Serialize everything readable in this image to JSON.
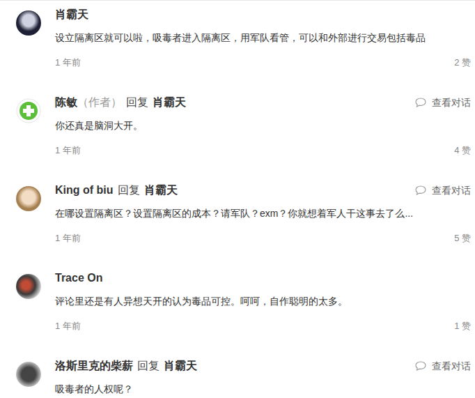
{
  "comments": [
    {
      "author": "肖霸天",
      "author_tag": "",
      "reply_label": "",
      "reply_to": "",
      "view_conversation": "",
      "text": "设立隔离区就可以啦，吸毒者进入隔离区，用军队看管，可以和外部进行交易包括毒品",
      "time": "1 年前",
      "likes": "2 赞"
    },
    {
      "author": "陈敏",
      "author_tag": "（作者）",
      "reply_label": "回复",
      "reply_to": "肖霸天",
      "view_conversation": "查看对话",
      "text": "你还真是脑洞大开。",
      "time": "1 年前",
      "likes": "4 赞"
    },
    {
      "author": "King of biu",
      "author_tag": "",
      "reply_label": "回复",
      "reply_to": "肖霸天",
      "view_conversation": "查看对话",
      "text": "在哪设置隔离区？设置隔离区的成本？请军队？exm？你就想着军人干这事去了么...",
      "time": "1 年前",
      "likes": "5 赞"
    },
    {
      "author": "Trace On",
      "author_tag": "",
      "reply_label": "",
      "reply_to": "",
      "view_conversation": "",
      "text": "评论里还是有人异想天开的认为毒品可控。呵呵，自作聪明的太多。",
      "time": "1 年前",
      "likes": "1 赞"
    },
    {
      "author": "洛斯里克的柴薪",
      "author_tag": "",
      "reply_label": "回复",
      "reply_to": "肖霸天",
      "view_conversation": "查看对话",
      "text": "吸毒者的人权呢？",
      "time": "",
      "likes": ""
    }
  ]
}
